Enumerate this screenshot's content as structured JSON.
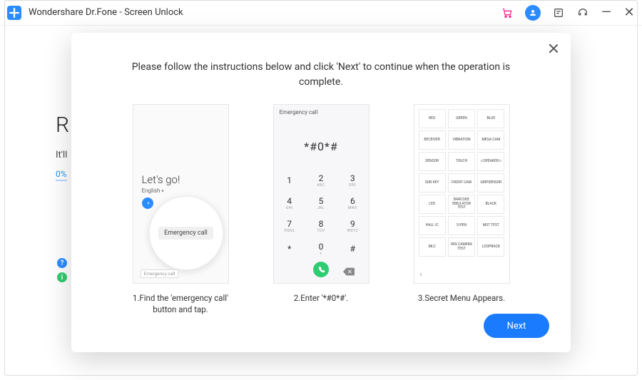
{
  "titlebar": {
    "app_title": "Wondershare Dr.Fone - Screen Unlock"
  },
  "background": {
    "letter": "R",
    "itll": "It'll",
    "progress": "0%",
    "help_badge": "?",
    "info_badge": "i"
  },
  "modal": {
    "instructions": "Please follow the instructions below and click 'Next' to continue when the operation is complete.",
    "next_label": "Next",
    "step1": {
      "lets_go": "Let's go!",
      "language": "English",
      "zoom_label": "Emergency call",
      "tag": "Emergency call",
      "caption": "1.Find the 'emergency call' button and tap."
    },
    "step2": {
      "header": "Emergency call",
      "code": "*#0*#",
      "keys": [
        {
          "num": "1",
          "sub": ""
        },
        {
          "num": "2",
          "sub": "ABC"
        },
        {
          "num": "3",
          "sub": "DEF"
        },
        {
          "num": "4",
          "sub": "GHI"
        },
        {
          "num": "5",
          "sub": "JKL"
        },
        {
          "num": "6",
          "sub": "MNO"
        },
        {
          "num": "7",
          "sub": "PQRS"
        },
        {
          "num": "8",
          "sub": "TUV"
        },
        {
          "num": "9",
          "sub": "WXYZ"
        },
        {
          "num": "*",
          "sub": ""
        },
        {
          "num": "0",
          "sub": "+"
        },
        {
          "num": "#",
          "sub": ""
        }
      ],
      "caption": "2.Enter '*#0*#'."
    },
    "step3": {
      "cells": [
        "RED",
        "GREEN",
        "BLUE",
        "RECEIVER",
        "VIBRATION",
        "MEGA CAM",
        "SENSOR",
        "TOUCH",
        "⊂SPEAKER⊃",
        "SUB KEY",
        "FRONT CAM",
        "GRIPSENSOR",
        "LED",
        "BARCODE EMULATOR TEST",
        "BLACK",
        "HALL IC",
        "S-PEN",
        "MST TEST",
        "MLC",
        "IRIS CAMERA TEST",
        "LOOPBACK"
      ],
      "back": "‹",
      "caption": "3.Secret Menu Appears."
    }
  }
}
